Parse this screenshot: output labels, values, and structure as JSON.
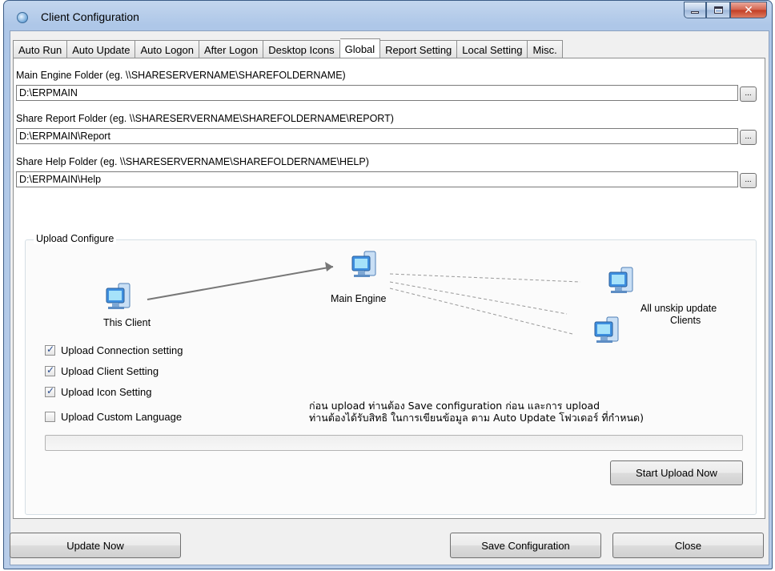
{
  "window": {
    "title": "Client Configuration"
  },
  "tabs": [
    {
      "label": "Auto Run",
      "active": false
    },
    {
      "label": "Auto Update",
      "active": false
    },
    {
      "label": "Auto Logon",
      "active": false
    },
    {
      "label": "After Logon",
      "active": false
    },
    {
      "label": "Desktop Icons",
      "active": false
    },
    {
      "label": "Global",
      "active": true
    },
    {
      "label": "Report Setting",
      "active": false
    },
    {
      "label": "Local Setting",
      "active": false
    },
    {
      "label": "Misc.",
      "active": false
    }
  ],
  "folders": {
    "main_engine": {
      "label": "Main Engine Folder (eg. \\\\SHARESERVERNAME\\SHAREFOLDERNAME)",
      "value": "D:\\ERPMAIN",
      "browse": "..."
    },
    "share_report": {
      "label": "Share Report Folder  (eg. \\\\SHARESERVERNAME\\SHAREFOLDERNAME\\REPORT)",
      "value": "D:\\ERPMAIN\\Report",
      "browse": "..."
    },
    "share_help": {
      "label": "Share Help Folder  (eg. \\\\SHARESERVERNAME\\SHAREFOLDERNAME\\HELP)",
      "value": "D:\\ERPMAIN\\Help",
      "browse": "..."
    }
  },
  "upload": {
    "group_title": "Upload Configure",
    "diagram": {
      "this_client": "This Client",
      "main_engine": "Main Engine",
      "all_clients_line1": "All unskip update",
      "all_clients_line2": "Clients"
    },
    "options": [
      {
        "label": "Upload Connection setting",
        "checked": true
      },
      {
        "label": "Upload Client Setting",
        "checked": true
      },
      {
        "label": "Upload Icon Setting",
        "checked": true
      },
      {
        "label": "Upload Custom Language",
        "checked": false
      }
    ],
    "note_line1": "ก่อน upload ท่านต้อง Save configuration ก่อน และการ upload",
    "note_line2": "ท่านต้องได้รับสิทธิ ในการเขียนข้อมูล ตาม Auto Update โฟวเดอร์ ที่กำหนด)",
    "progress": 0,
    "start_button": "Start Upload Now"
  },
  "footer": {
    "update_now": "Update Now",
    "save_configuration": "Save Configuration",
    "close": "Close"
  },
  "colors": {
    "accent": "#3b5c86",
    "progress": "#4cb84c"
  }
}
